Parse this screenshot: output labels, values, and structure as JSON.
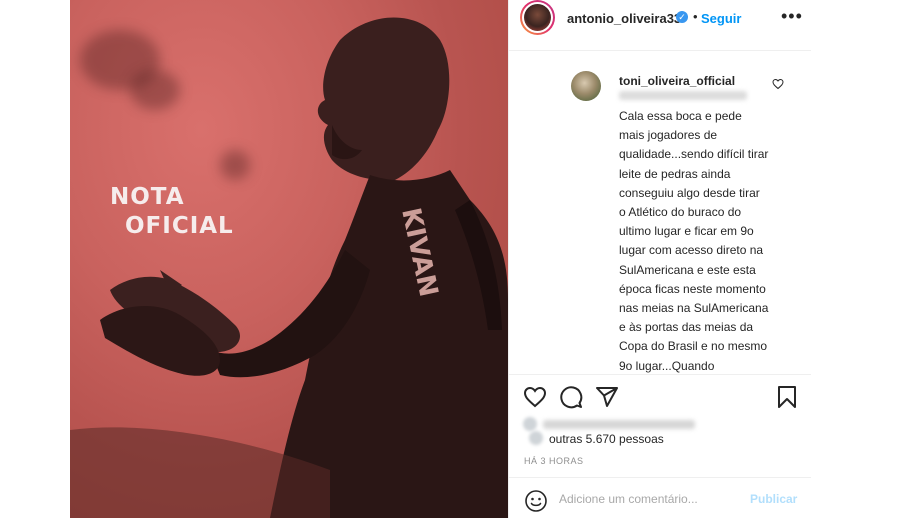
{
  "post": {
    "image_text_line1": "NOTA",
    "image_text_line2": "OFICIAL"
  },
  "header": {
    "username": "antonio_oliveira33",
    "verified_icon": "verified-badge-icon",
    "separator": "•",
    "follow_label": "Seguir",
    "more_icon": "ellipsis-icon"
  },
  "comment": {
    "username": "toni_oliveira_official",
    "text": "Cala essa boca e pede mais jogadores de qualidade...sendo difícil tirar leite de pedras ainda conseguiu algo desde tirar o Atlético do buraco do ultimo lugar e ficar em 9o lugar com acesso direto na SulAmericana e este esta época ficas neste momento nas meias na SulAmericana e às portas das meias da Copa do Brasil e no mesmo 9o lugar...Quando venderam o Atlético..."
  },
  "likes": {
    "text": "outras 5.670 pessoas"
  },
  "timestamp": "HÁ 3 HORAS",
  "composer": {
    "placeholder": "Adicione um comentário...",
    "publish_label": "Publicar"
  },
  "colors": {
    "accent": "#0095f6",
    "publish_disabled": "#b2dffc",
    "image_red": "#c9625e"
  }
}
